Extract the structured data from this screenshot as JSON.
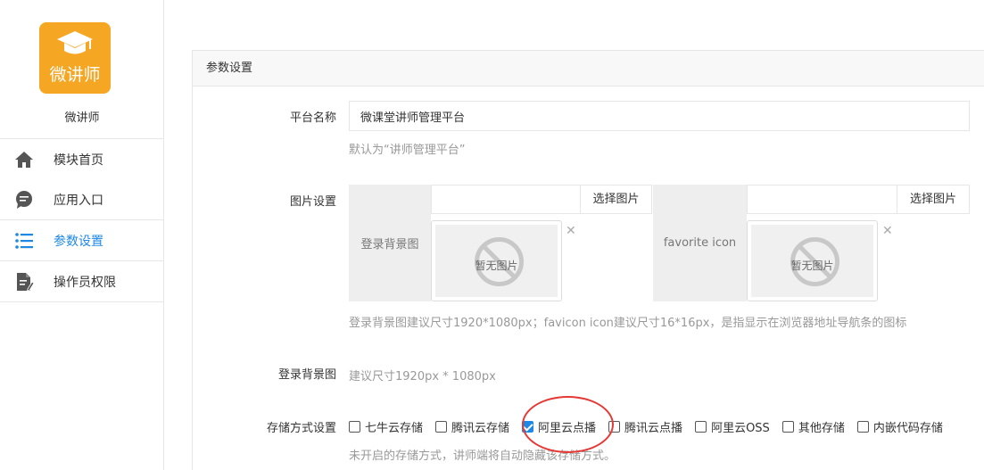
{
  "app": {
    "logo_text": "微讲师",
    "name": "微讲师"
  },
  "nav": {
    "items": [
      {
        "label": "模块首页",
        "icon": "home-icon"
      },
      {
        "label": "应用入口",
        "icon": "chat-bubble-icon"
      },
      {
        "label": "参数设置",
        "icon": "list-icon",
        "active": true
      },
      {
        "label": "操作员权限",
        "icon": "document-edit-icon"
      }
    ]
  },
  "panel": {
    "title": "参数设置",
    "platform_name": {
      "label": "平台名称",
      "value": "微课堂讲师管理平台",
      "hint": "默认为“讲师管理平台”"
    },
    "image_settings": {
      "label": "图片设置",
      "login_bg": {
        "side_label": "登录背景图",
        "button": "选择图片",
        "placeholder_text": "暂无图片"
      },
      "favicon": {
        "side_label": "favorite icon",
        "button": "选择图片",
        "placeholder_text": "暂无图片"
      },
      "hint": "登录背景图建议尺寸1920*1080px；favicon icon建议尺寸16*16px，是指显示在浏览器地址导航条的图标"
    },
    "login_bg_row": {
      "label": "登录背景图",
      "hint": "建议尺寸1920px * 1080px"
    },
    "storage": {
      "label": "存储方式设置",
      "options": [
        {
          "label": "七牛云存储",
          "checked": false
        },
        {
          "label": "腾讯云存储",
          "checked": false
        },
        {
          "label": "阿里云点播",
          "checked": true
        },
        {
          "label": "腾讯云点播",
          "checked": false
        },
        {
          "label": "阿里云OSS",
          "checked": false
        },
        {
          "label": "其他存储",
          "checked": false
        },
        {
          "label": "内嵌代码存储",
          "checked": false
        }
      ],
      "hint": "未开启的存储方式，讲师端将自动隐藏该存储方式。"
    }
  },
  "colors": {
    "accent": "#1e88e5",
    "logo_bg": "#f5a623",
    "annotation": "#e53935"
  }
}
